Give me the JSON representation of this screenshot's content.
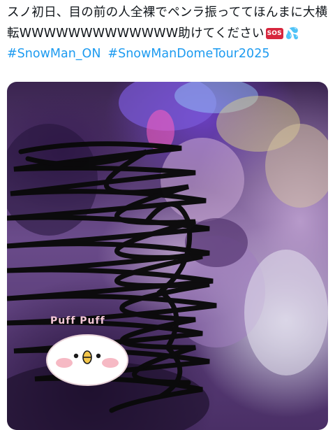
{
  "tweet": {
    "text": "スノ初日、目の前の人全裸でペンラ振っててほんまに大横転WWWWWWWWWWWWW助けてください",
    "badge": "SOS",
    "hashtags": [
      "#SnowMan_ON",
      "#SnowManDomeTour2025"
    ]
  },
  "media": {
    "sticker_text": "Puff Puff"
  },
  "colors": {
    "hashtag": "#1d9bf0",
    "text": "#0f1419",
    "sos_badge": "#d7263d"
  },
  "icons": [
    "sos-icon",
    "sweat-drops-icon"
  ]
}
